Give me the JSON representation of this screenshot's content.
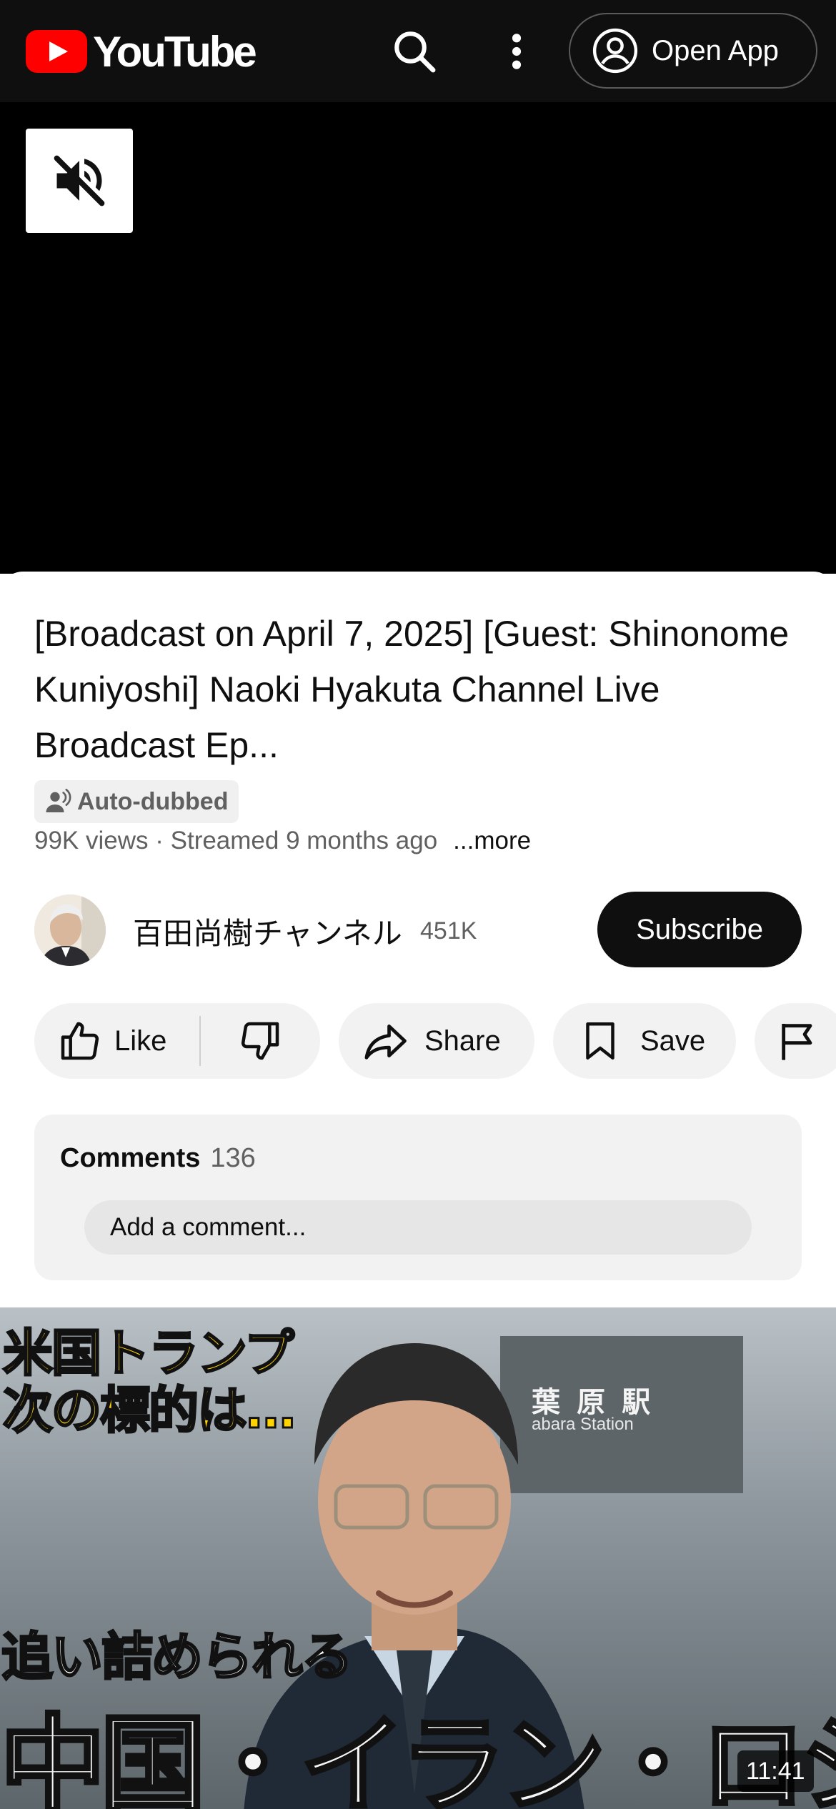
{
  "header": {
    "logo_text": "YouTube",
    "open_app_label": "Open App",
    "icons": [
      "search-icon",
      "more-vertical-icon",
      "account-circle-icon"
    ],
    "brand_color": "#ff0000"
  },
  "player": {
    "mute_icon": "volume-muted-icon"
  },
  "video": {
    "title": "[Broadcast on April 7, 2025] [Guest: Shinonome Kuniyoshi] Naoki Hyakuta Channel Live Broadcast Ep...",
    "auto_dubbed_label": "Auto-dubbed",
    "meta": "99K views · Streamed 9 months ago",
    "more_label": "...more"
  },
  "channel": {
    "name": "百田尚樹チャンネル",
    "subscribers": "451K",
    "subscribe_label": "Subscribe"
  },
  "actions": {
    "like_label": "Like",
    "share_label": "Share",
    "save_label": "Save"
  },
  "comments": {
    "title": "Comments",
    "count": "136",
    "placeholder": "Add a comment..."
  },
  "next_video": {
    "thumb_text_top_line1": "米国トランプ",
    "thumb_text_top_line2": "次の標的は…",
    "thumb_text_mid": "追い詰められる",
    "thumb_text_big": "中国・イラン・ロシア",
    "station_sign": "葉 原 駅",
    "station_sign_sub": "abara Station",
    "duration": "11:41"
  }
}
